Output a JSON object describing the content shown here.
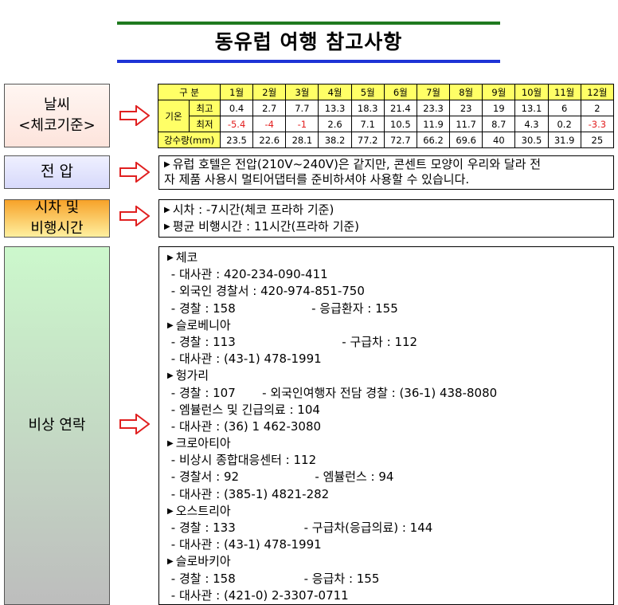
{
  "title": "동유럽 여행 참고사항",
  "labels": {
    "weather_line1": "날씨",
    "weather_line2": "<체코기준>",
    "voltage": "전 압",
    "time_line1": "시차 및",
    "time_line2": "비행시간",
    "emergency": "비상 연락"
  },
  "weather": {
    "header": [
      "구 분",
      "1월",
      "2월",
      "3월",
      "4월",
      "5월",
      "6월",
      "7월",
      "8월",
      "9월",
      "10월",
      "11월",
      "12월"
    ],
    "temp_label": "기온",
    "max_label": "최고",
    "min_label": "최저",
    "rain_label": "강수량(mm)",
    "max": [
      "0.4",
      "2.7",
      "7.7",
      "13.3",
      "18.3",
      "21.4",
      "23.3",
      "23",
      "19",
      "13.1",
      "6",
      "2"
    ],
    "min": [
      "-5.4",
      "-4",
      "-1",
      "2.6",
      "7.1",
      "10.5",
      "11.9",
      "11.7",
      "8.7",
      "4.3",
      "0.2",
      "-3.3"
    ],
    "rain": [
      "23.5",
      "22.6",
      "28.1",
      "38.2",
      "77.2",
      "72.7",
      "66.2",
      "69.6",
      "40",
      "30.5",
      "31.9",
      "25"
    ]
  },
  "voltage": {
    "line1": "유럽 호텔은 전압(210V~240V)은 같지만, 콘센트 모양이 우리와 달라 전",
    "line2": "자 제품 사용시 멀티어댑터를 준비하셔야 사용할 수 있습니다."
  },
  "time": {
    "line1": "시차 : -7시간(체코 프라하 기준)",
    "line2": "평균 비행시간 : 11시간(프라하 기준)"
  },
  "emergency": {
    "lines": [
      "체코",
      " - 대사관 : 420-234-090-411",
      " - 외국인 경찰서 : 420-974-851-750",
      " - 경찰 : 158                    - 응급환자 : 155",
      "슬로베니아",
      " - 경찰 : 113                            - 구급차 : 112",
      " - 대사관 : (43-1) 478-1991",
      "헝가리",
      " - 경찰 : 107       - 외국인여행자 전담 경찰 : (36-1) 438-8080",
      " - 엠뷸런스 및 긴급의료 : 104",
      " - 대사관 : (36) 1 462-3080",
      "크로아티아",
      " - 비상시 종합대응센터 : 112",
      " - 경찰서 : 92                    - 엠뷸런스 : 94",
      " - 대사관 : (385-1) 4821-282",
      "오스트리아",
      " - 경찰 : 133                  - 구급차(응급의료) : 144",
      " - 대사관 : (43-1) 478-1991",
      "슬로바키아",
      " - 경찰 : 158                  - 응급차 : 155",
      " - 대사관 : (421-0) 2-3307-0711"
    ],
    "country_line_indices": [
      0,
      4,
      7,
      11,
      15,
      18
    ]
  },
  "colors": {
    "title_bar_top": "#1f7a1f",
    "title_bar_bottom": "#1e33d6",
    "table_header": "#ffff66",
    "negative_temp": "#e32020",
    "arrow": "#e02020"
  },
  "icons": {
    "arrow": "outline-right-arrow-icon",
    "bullet": "small-triangle-bullet-icon"
  }
}
